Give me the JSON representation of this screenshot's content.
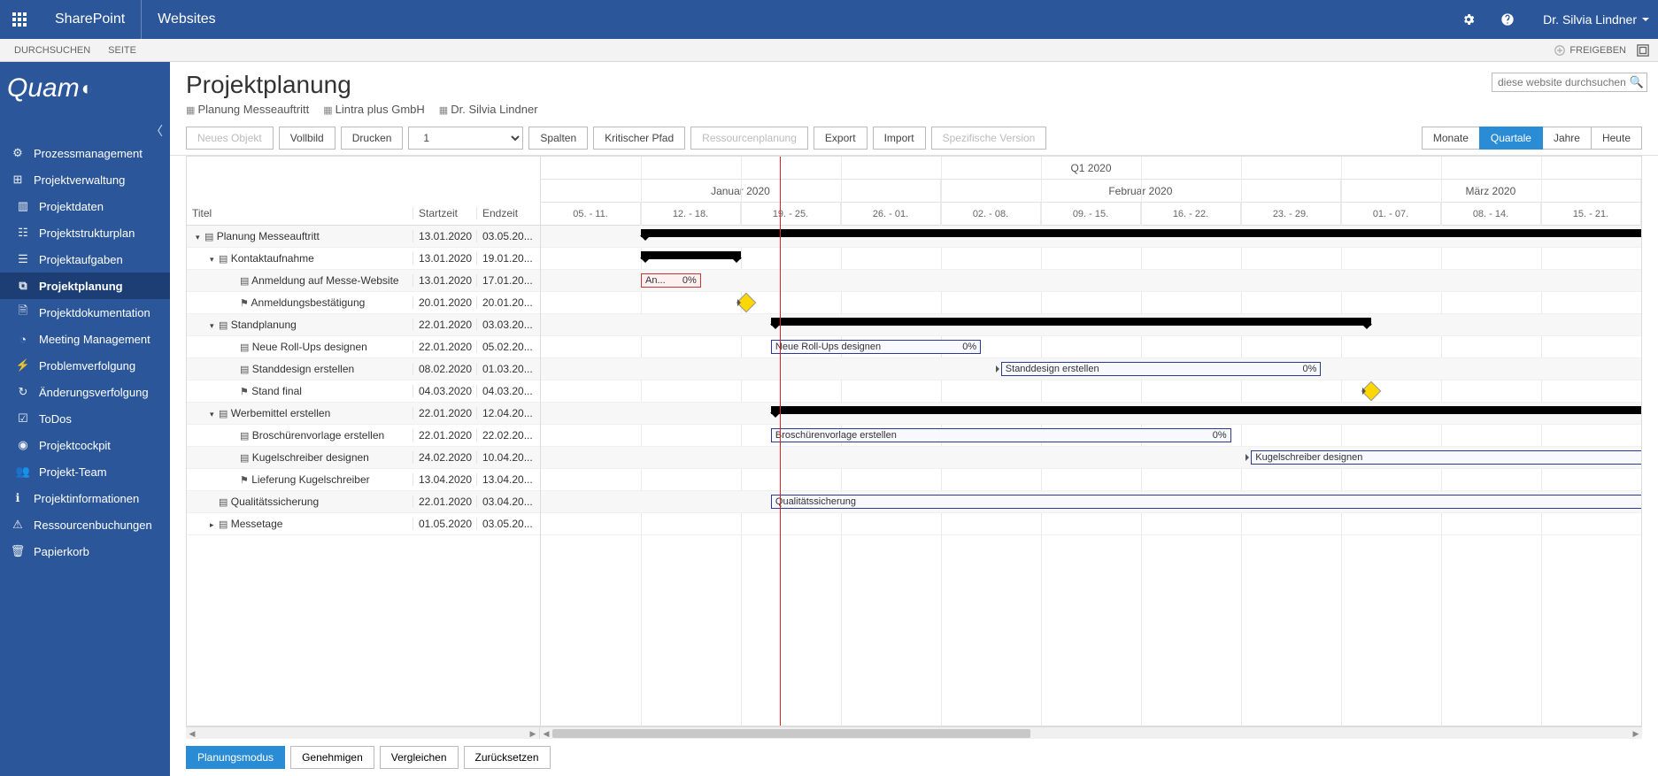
{
  "topbar": {
    "brand": "SharePoint",
    "sub": "Websites",
    "user": "Dr. Silvia Lindner"
  },
  "ribbon": {
    "tabs": [
      "DURCHSUCHEN",
      "SEITE"
    ],
    "share": "FREIGEBEN"
  },
  "sidebar": {
    "logo": "Quam",
    "items": [
      {
        "label": "Prozessmanagement",
        "icon": "process"
      },
      {
        "label": "Projektverwaltung",
        "icon": "project",
        "active": true
      },
      {
        "label": "Projektdaten",
        "icon": "bars",
        "sub": true
      },
      {
        "label": "Projektstrukturplan",
        "icon": "struct",
        "sub": true
      },
      {
        "label": "Projektaufgaben",
        "icon": "tasks",
        "sub": true
      },
      {
        "label": "Projektplanung",
        "icon": "plan",
        "sub": true,
        "current": true
      },
      {
        "label": "Projektdokumentation",
        "icon": "doc",
        "sub": true
      },
      {
        "label": "Meeting Management",
        "icon": "meet",
        "sub": true
      },
      {
        "label": "Problemverfolgung",
        "icon": "issue",
        "sub": true
      },
      {
        "label": "Änderungsverfolgung",
        "icon": "change",
        "sub": true
      },
      {
        "label": "ToDos",
        "icon": "todo",
        "sub": true
      },
      {
        "label": "Projektcockpit",
        "icon": "cockpit",
        "sub": true
      },
      {
        "label": "Projekt-Team",
        "icon": "team",
        "sub": true
      },
      {
        "label": "Projektinformationen",
        "icon": "info"
      },
      {
        "label": "Ressourcenbuchungen",
        "icon": "res"
      },
      {
        "label": "Papierkorb",
        "icon": "trash"
      }
    ]
  },
  "header": {
    "title": "Projektplanung",
    "crumbs": [
      "Planung Messeauftritt",
      "Lintra plus GmbH",
      "Dr. Silvia Lindner"
    ],
    "search_placeholder": "diese website durchsuchen"
  },
  "toolbar": {
    "neues": "Neues Objekt",
    "vollbild": "Vollbild",
    "drucken": "Drucken",
    "zoom_val": "1",
    "spalten": "Spalten",
    "kritisch": "Kritischer Pfad",
    "ressourcen": "Ressourcenplanung",
    "export": "Export",
    "import": "Import",
    "spezifisch": "Spezifische Version",
    "monate": "Monate",
    "quartale": "Quartale",
    "jahre": "Jahre",
    "heute": "Heute"
  },
  "gantt": {
    "cols": {
      "title": "Titel",
      "start": "Startzeit",
      "end": "Endzeit"
    },
    "quarter": "Q1 2020",
    "months": [
      "Januar 2020",
      "Februar 2020",
      "März 2020"
    ],
    "weeks": [
      "05. - 11.",
      "12. - 18.",
      "19. - 25.",
      "26. - 01.",
      "02. - 08.",
      "09. - 15.",
      "16. - 22.",
      "23. - 29.",
      "01. - 07.",
      "08. - 14.",
      "15. - 21."
    ],
    "rows": [
      {
        "title": "Planung Messeauftritt",
        "start": "13.01.2020",
        "end": "03.05.20...",
        "level": 0,
        "type": "summary",
        "expanded": true
      },
      {
        "title": "Kontaktaufnahme",
        "start": "13.01.2020",
        "end": "19.01.20...",
        "level": 1,
        "type": "summary",
        "expanded": true
      },
      {
        "title": "Anmeldung auf Messe-Website",
        "start": "13.01.2020",
        "end": "17.01.20...",
        "level": 2,
        "type": "task",
        "bar_label": "An...",
        "pct": "0%"
      },
      {
        "title": "Anmeldungsbestätigung",
        "start": "20.01.2020",
        "end": "20.01.20...",
        "level": 2,
        "type": "milestone"
      },
      {
        "title": "Standplanung",
        "start": "22.01.2020",
        "end": "03.03.20...",
        "level": 1,
        "type": "summary",
        "expanded": true
      },
      {
        "title": "Neue Roll-Ups designen",
        "start": "22.01.2020",
        "end": "05.02.20...",
        "level": 2,
        "type": "task",
        "bar_label": "Neue Roll-Ups designen",
        "pct": "0%"
      },
      {
        "title": "Standdesign erstellen",
        "start": "08.02.2020",
        "end": "01.03.20...",
        "level": 2,
        "type": "task",
        "bar_label": "Standdesign erstellen",
        "pct": "0%"
      },
      {
        "title": "Stand final",
        "start": "04.03.2020",
        "end": "04.03.20...",
        "level": 2,
        "type": "milestone"
      },
      {
        "title": "Werbemittel erstellen",
        "start": "22.01.2020",
        "end": "12.04.20...",
        "level": 1,
        "type": "summary",
        "expanded": true
      },
      {
        "title": "Broschürenvorlage erstellen",
        "start": "22.01.2020",
        "end": "22.02.20...",
        "level": 2,
        "type": "task",
        "bar_label": "Broschürenvorlage erstellen",
        "pct": "0%"
      },
      {
        "title": "Kugelschreiber designen",
        "start": "24.02.2020",
        "end": "10.04.20...",
        "level": 2,
        "type": "task",
        "bar_label": "Kugelschreiber designen"
      },
      {
        "title": "Lieferung Kugelschreiber",
        "start": "13.04.2020",
        "end": "13.04.20...",
        "level": 2,
        "type": "milestone"
      },
      {
        "title": "Qualitätssicherung",
        "start": "22.01.2020",
        "end": "03.04.20...",
        "level": 1,
        "type": "task",
        "bar_label": "Qualitätssicherung"
      },
      {
        "title": "Messetage",
        "start": "01.05.2020",
        "end": "03.05.20...",
        "level": 1,
        "type": "summary"
      }
    ]
  },
  "footer": {
    "planungsmodus": "Planungsmodus",
    "genehmigen": "Genehmigen",
    "vergleichen": "Vergleichen",
    "zuruck": "Zurücksetzen"
  }
}
